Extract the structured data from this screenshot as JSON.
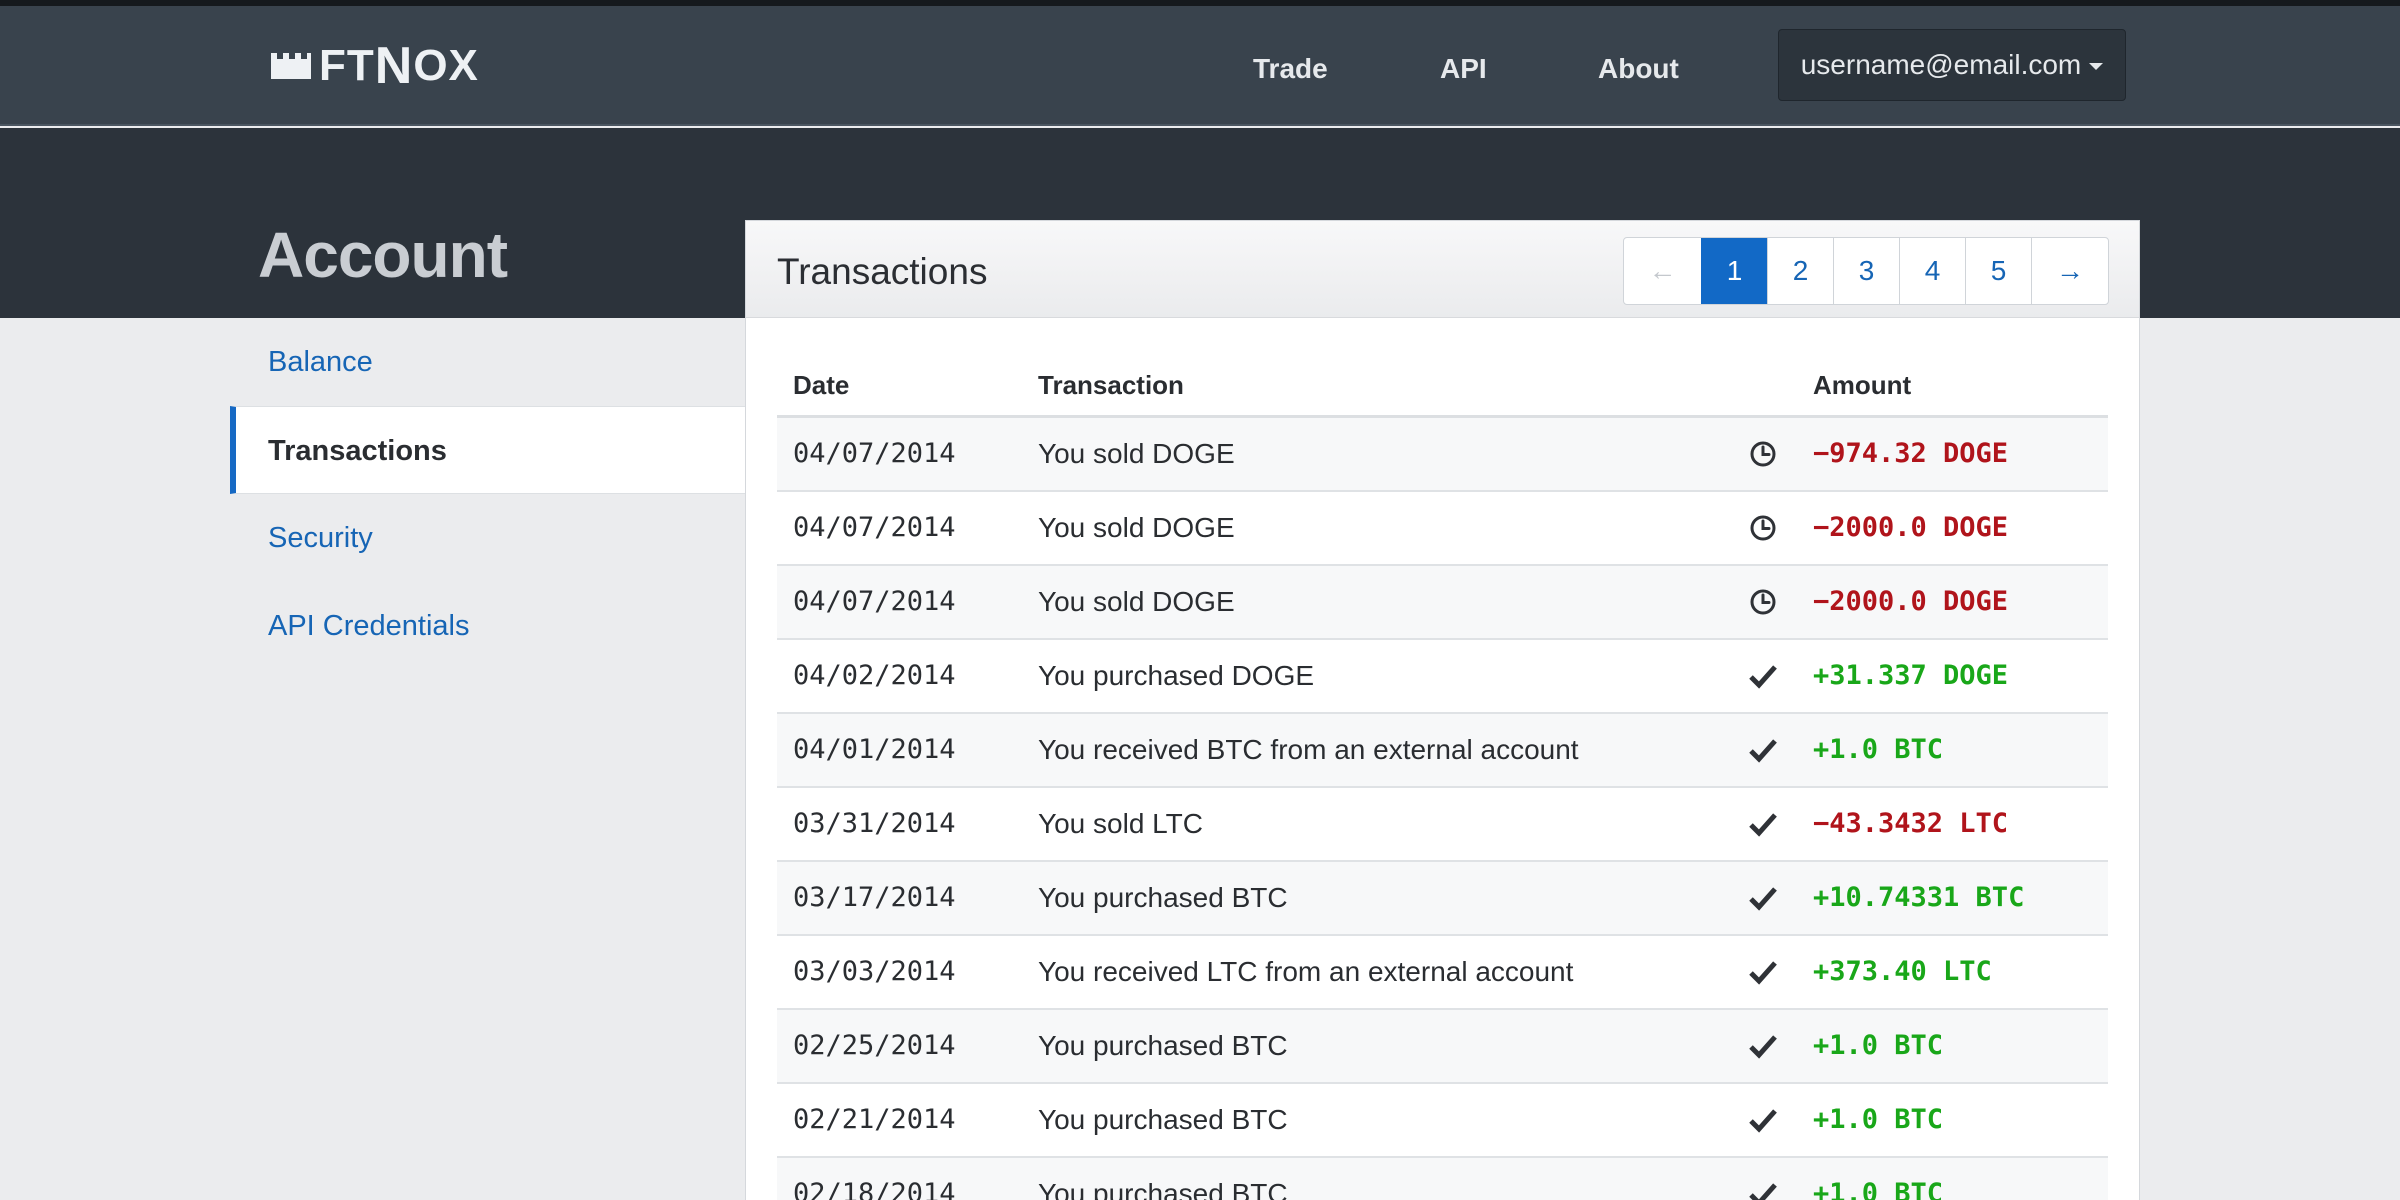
{
  "brand": {
    "name_prefix": "FT",
    "name_big": "N",
    "name_suffix": "OX"
  },
  "nav": {
    "trade": "Trade",
    "api": "API",
    "about": "About"
  },
  "user": {
    "email": "username@email.com"
  },
  "page_title": "Account",
  "sidebar": {
    "items": [
      {
        "label": "Balance",
        "active": false
      },
      {
        "label": "Transactions",
        "active": true
      },
      {
        "label": "Security",
        "active": false
      },
      {
        "label": "API Credentials",
        "active": false
      }
    ]
  },
  "panel": {
    "title": "Transactions"
  },
  "pagination": {
    "prev": "←",
    "pages": [
      "1",
      "2",
      "3",
      "4",
      "5"
    ],
    "next": "→",
    "current": "1"
  },
  "table": {
    "columns": {
      "date": "Date",
      "transaction": "Transaction",
      "amount": "Amount"
    },
    "rows": [
      {
        "date": "04/07/2014",
        "desc": "You sold DOGE",
        "status": "pending",
        "amount": "−974.32 DOGE",
        "sign": "negative"
      },
      {
        "date": "04/07/2014",
        "desc": "You sold DOGE",
        "status": "pending",
        "amount": "−2000.0 DOGE",
        "sign": "negative"
      },
      {
        "date": "04/07/2014",
        "desc": "You sold DOGE",
        "status": "pending",
        "amount": "−2000.0 DOGE",
        "sign": "negative"
      },
      {
        "date": "04/02/2014",
        "desc": "You purchased DOGE",
        "status": "complete",
        "amount": "+31.337 DOGE",
        "sign": "positive"
      },
      {
        "date": "04/01/2014",
        "desc": "You received BTC from an external account",
        "status": "complete",
        "amount": "+1.0 BTC",
        "sign": "positive"
      },
      {
        "date": "03/31/2014",
        "desc": "You sold LTC",
        "status": "complete",
        "amount": "−43.3432 LTC",
        "sign": "negative"
      },
      {
        "date": "03/17/2014",
        "desc": "You purchased BTC",
        "status": "complete",
        "amount": "+10.74331 BTC",
        "sign": "positive"
      },
      {
        "date": "03/03/2014",
        "desc": "You received LTC from an external account",
        "status": "complete",
        "amount": "+373.40 LTC",
        "sign": "positive"
      },
      {
        "date": "02/25/2014",
        "desc": "You purchased BTC",
        "status": "complete",
        "amount": "+1.0 BTC",
        "sign": "positive"
      },
      {
        "date": "02/21/2014",
        "desc": "You purchased BTC",
        "status": "complete",
        "amount": "+1.0 BTC",
        "sign": "positive"
      },
      {
        "date": "02/18/2014",
        "desc": "You purchased BTC",
        "status": "complete",
        "amount": "+1.0 BTC",
        "sign": "positive"
      }
    ]
  },
  "icons": {
    "pending": "clock-icon",
    "complete": "check-icon",
    "logo": "castle-icon"
  },
  "colors": {
    "negative": "#b0141b",
    "positive": "#19a719",
    "accent": "#1269c6",
    "link": "#1665b5"
  }
}
